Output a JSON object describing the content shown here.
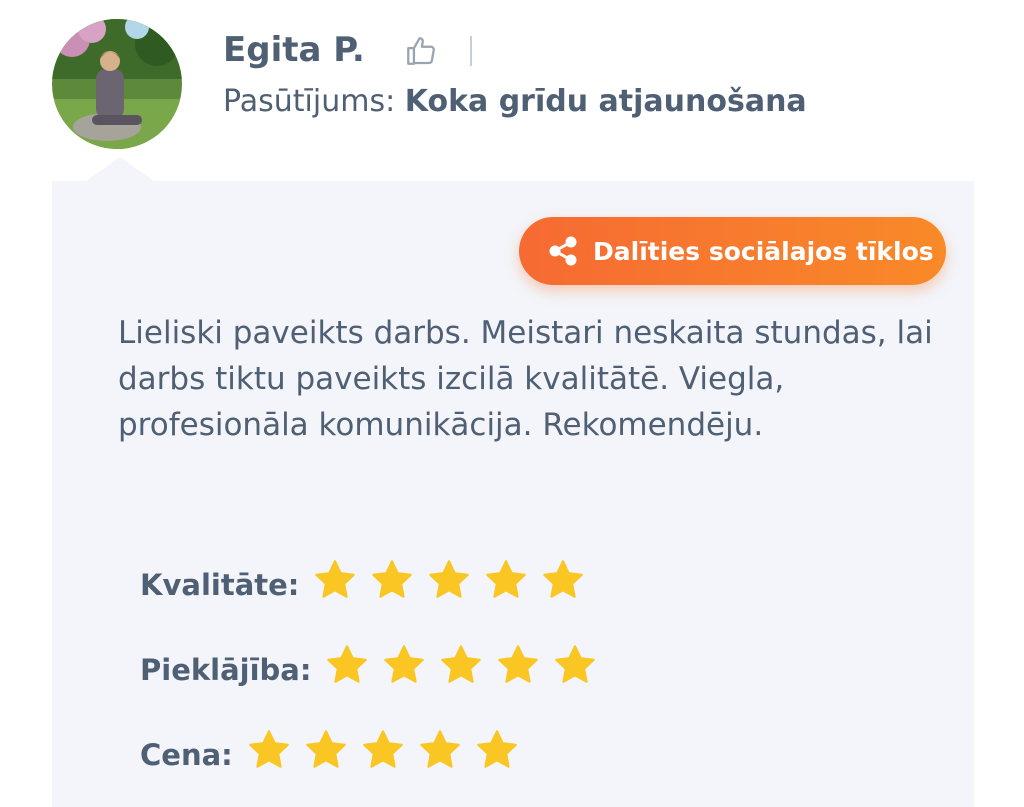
{
  "review": {
    "reviewer_name": "Egita P.",
    "order_label": "Pasūtījums:",
    "order_value": "Koka grīdu atjaunošana",
    "share_label": "Dalīties sociālajos tīklos",
    "text": "Lieliski paveikts darbs. Meistari neskaita stundas, lai darbs tiktu paveikts izcilā kvalitātē. Viegla, profesionāla komunikācija. Rekomendēju."
  },
  "ratings": [
    {
      "label": "Kvalitāte:",
      "stars": 5,
      "max": 5
    },
    {
      "label": "Pieklājība:",
      "stars": 5,
      "max": 5
    },
    {
      "label": "Cena:",
      "stars": 5,
      "max": 5
    }
  ],
  "icons": {
    "like": "thumbs-up-icon",
    "share": "share-icon",
    "star": "star-icon"
  },
  "colors": {
    "text": "#4f5f74",
    "accent_start": "#f66a33",
    "accent_end": "#f98a28",
    "star": "#f9c623",
    "card_bg": "#f3f5fa"
  }
}
